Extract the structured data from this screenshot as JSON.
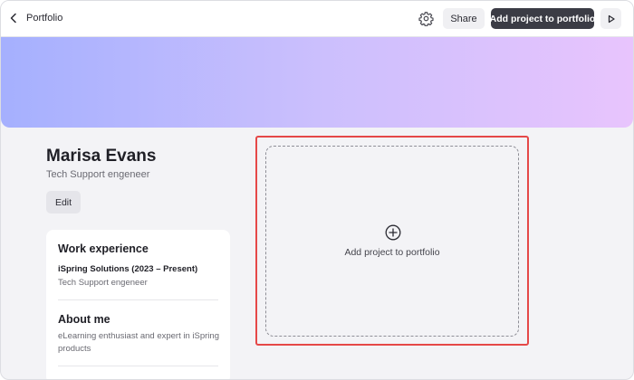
{
  "topbar": {
    "back_label": "Portfolio",
    "back_icon": "chevron-left-icon",
    "settings_icon": "gear-icon",
    "share_label": "Share",
    "add_project_label": "Add project to portfolio",
    "preview_icon": "play-icon"
  },
  "banner": {
    "gradient_colors": [
      "#a5b0fe",
      "#cbbffd",
      "#e8c4fd"
    ]
  },
  "profile": {
    "name": "Marisa Evans",
    "role": "Tech Support engeneer",
    "edit_label": "Edit"
  },
  "work_experience": {
    "title": "Work experience",
    "company": "iSpring Solutions (2023 – Present)",
    "position": "Tech Support engeneer"
  },
  "about": {
    "title": "About me",
    "text": "eLearning enthusiast and expert in iSpring products"
  },
  "dropzone": {
    "label": "Add project to portfolio",
    "icon": "plus-circle-icon",
    "highlight_color": "#e54848"
  },
  "colors": {
    "primary_button": "#3b3c45",
    "page_background": "#f3f3f6"
  }
}
